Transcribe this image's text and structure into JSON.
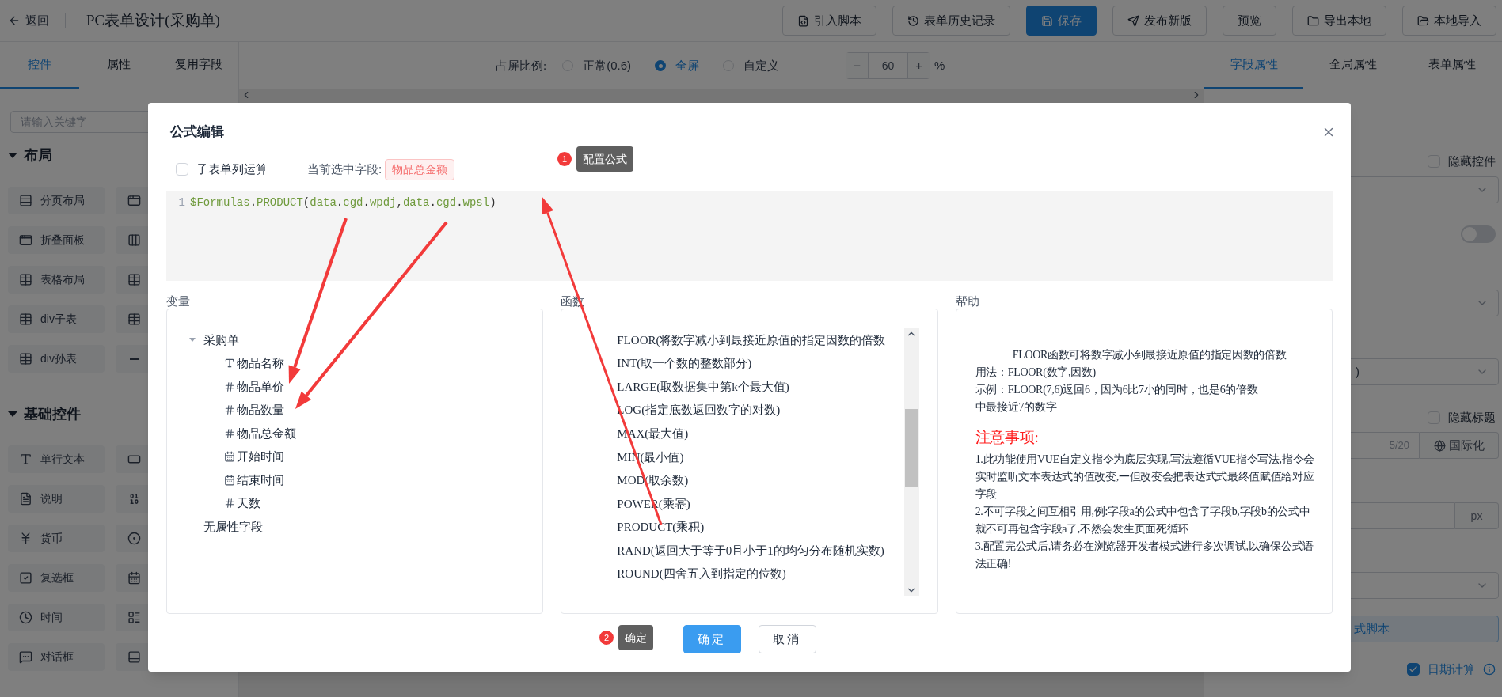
{
  "top_bar": {
    "back": "返回",
    "title": "PC表单设计(采购单)",
    "buttons": [
      {
        "label": "引入脚本",
        "kind": "script",
        "primary": false
      },
      {
        "label": "表单历史记录",
        "kind": "history",
        "primary": false
      },
      {
        "label": "保存",
        "kind": "save",
        "primary": true
      },
      {
        "label": "发布新版",
        "kind": "publish",
        "primary": false
      },
      {
        "label": "预览",
        "kind": "preview",
        "primary": false
      },
      {
        "label": "导出本地",
        "kind": "export",
        "primary": false
      },
      {
        "label": "本地导入",
        "kind": "import",
        "primary": false
      }
    ]
  },
  "left_panel": {
    "tabs": [
      {
        "label": "控件",
        "selected": true
      },
      {
        "label": "属性",
        "selected": false
      },
      {
        "label": "复用字段",
        "selected": false
      }
    ],
    "search": {
      "placeholder": "请输入关键字"
    },
    "sections": [
      {
        "title": "布局",
        "expanded": true,
        "items": [
          {
            "label": "分页布局",
            "kind": "pagination"
          },
          {
            "label": "折叠面板",
            "kind": "collapse"
          },
          {
            "label": "表格布局",
            "kind": "table"
          },
          {
            "label": "div子表",
            "kind": "subtable"
          },
          {
            "label": "div孙表",
            "kind": "grandtable"
          }
        ]
      },
      {
        "title": "基础控件",
        "expanded": true,
        "items": [
          {
            "label": "单行文本",
            "kind": "text"
          },
          {
            "label": "说明",
            "kind": "note"
          },
          {
            "label": "货币",
            "kind": "currency"
          },
          {
            "label": "复选框",
            "kind": "checkbox"
          },
          {
            "label": "时间",
            "kind": "time"
          },
          {
            "label": "对话框",
            "kind": "dialog"
          }
        ]
      }
    ]
  },
  "canvas": {
    "ratio_label": "占屏比例:",
    "options": [
      {
        "label": "正常(0.6)",
        "selected": false
      },
      {
        "label": "全屏",
        "selected": true
      },
      {
        "label": "自定义",
        "selected": false
      }
    ],
    "stepper": {
      "minus": "−",
      "value": "60",
      "plus": "+",
      "unit": "%"
    }
  },
  "right_panel": {
    "tabs": [
      {
        "label": "字段属性",
        "selected": true
      },
      {
        "label": "全局属性",
        "selected": false
      },
      {
        "label": "表单属性",
        "selected": false
      }
    ],
    "fields": [
      {
        "kind": "checkbox",
        "label": "隐藏控件",
        "checked": false
      },
      {
        "kind": "select"
      },
      {
        "kind": "switch",
        "on": false
      },
      {
        "kind": "select"
      },
      {
        "kind": "select",
        "value": ")"
      },
      {
        "kind": "checkbox",
        "label": "隐藏标题",
        "checked": false
      },
      {
        "kind": "i18n_input",
        "count": "5/20",
        "button": "国际化"
      },
      {
        "kind": "unit_input",
        "unit": "px"
      },
      {
        "kind": "select"
      },
      {
        "kind": "button",
        "label": "式脚本"
      },
      {
        "kind": "checkbox",
        "label": "日期计算",
        "checked": true,
        "info": true
      }
    ]
  },
  "dialog": {
    "title": "公式编辑",
    "subtable_calc": {
      "label": "子表单列运算",
      "checked": false
    },
    "current_field": {
      "label": "当前选中字段:",
      "tag": "物品总金额"
    },
    "editor": {
      "lines": [
        {
          "number": "1",
          "code": "$Formulas.PRODUCT(data.cgd.wpdj,data.cgd.wpsl)"
        }
      ]
    },
    "variables": {
      "title": "变量",
      "tree": [
        {
          "label": "采购单",
          "expanded": true,
          "children": [
            {
              "label": "物品名称",
              "kind": "text"
            },
            {
              "label": "物品单价",
              "kind": "number"
            },
            {
              "label": "物品数量",
              "kind": "number"
            },
            {
              "label": "物品总金额",
              "kind": "number"
            },
            {
              "label": "开始时间",
              "kind": "date"
            },
            {
              "label": "结束时间",
              "kind": "date"
            },
            {
              "label": "天数",
              "kind": "number"
            }
          ]
        },
        {
          "label": "无属性字段"
        }
      ]
    },
    "functions": {
      "title": "函数",
      "items": [
        "FLOOR(将数字减小到最接近原值的指定因数的倍数",
        "INT(取一个数的整数部分)",
        "LARGE(取数据集中第k个最大值)",
        "LOG(指定底数返回数字的对数)",
        "MAX(最大值)",
        "MIN(最小值)",
        "MOD(取余数)",
        "POWER(乘幂)",
        "PRODUCT(乘积)",
        "RAND(返回大于等于0且小于1的均匀分布随机实数)",
        "ROUND(四舍五入到指定的位数)"
      ]
    },
    "help": {
      "title": "帮助",
      "summary": "FLOOR函数可将数字减小到最接近原值的指定因数的倍数",
      "lines": [
        "用法：FLOOR(数字,因数)",
        "示例：FLOOR(7,6)返回6，因为6比7小的同时，也是6的倍数",
        "中最接近7的数字"
      ],
      "notes_title": "注意事项:",
      "notes": [
        "1.此功能使用VUE自定义指令为底层实现,写法遵循VUE指令写法,指令会实时监听文本表达式的值改变,一但改变会把表达式式最终值赋值给对应字段",
        "2.不可字段之间互相引用,例:字段a的公式中包含了字段b,字段b的公式中就不可再包含字段a了,不然会发生页面死循环",
        "3.配置完公式后,请务必在浏览器开发者模式进行多次调试,以确保公式语法正确!"
      ]
    },
    "buttons": [
      {
        "label": "确定",
        "primary": true
      },
      {
        "label": "取消",
        "primary": false
      }
    ]
  },
  "annotations": [
    {
      "number": "1",
      "text": "配置公式"
    },
    {
      "number": "2",
      "text": "确定"
    }
  ]
}
